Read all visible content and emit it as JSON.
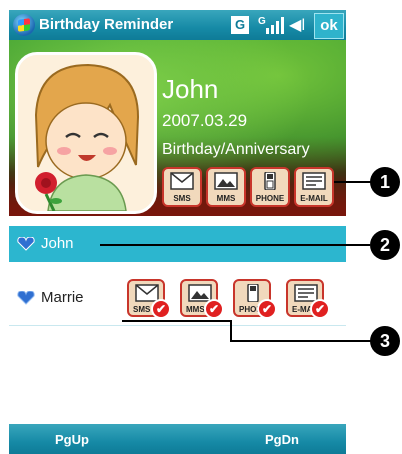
{
  "titlebar": {
    "title": "Birthday Reminder",
    "g_label": "G",
    "ok_label": "ok"
  },
  "contact": {
    "name": "John",
    "date": "2007.03.29",
    "occasion": "Birthday/Anniversary"
  },
  "actions": [
    "SMS",
    "MMS",
    "PHONE",
    "E-MAIL"
  ],
  "list": [
    {
      "name": "John",
      "selected": true
    },
    {
      "name": "Marrie",
      "selected": false,
      "actions": [
        "SMS",
        "MMS",
        "PHONE",
        "E-MAIL"
      ]
    }
  ],
  "softkeys": {
    "left": "PgUp",
    "right": "PgDn"
  },
  "callouts": [
    "1",
    "2",
    "3"
  ],
  "colors": {
    "titlebar": "#168aa6",
    "selected_row": "#2cb6cf",
    "accent_red": "#c8352b"
  }
}
